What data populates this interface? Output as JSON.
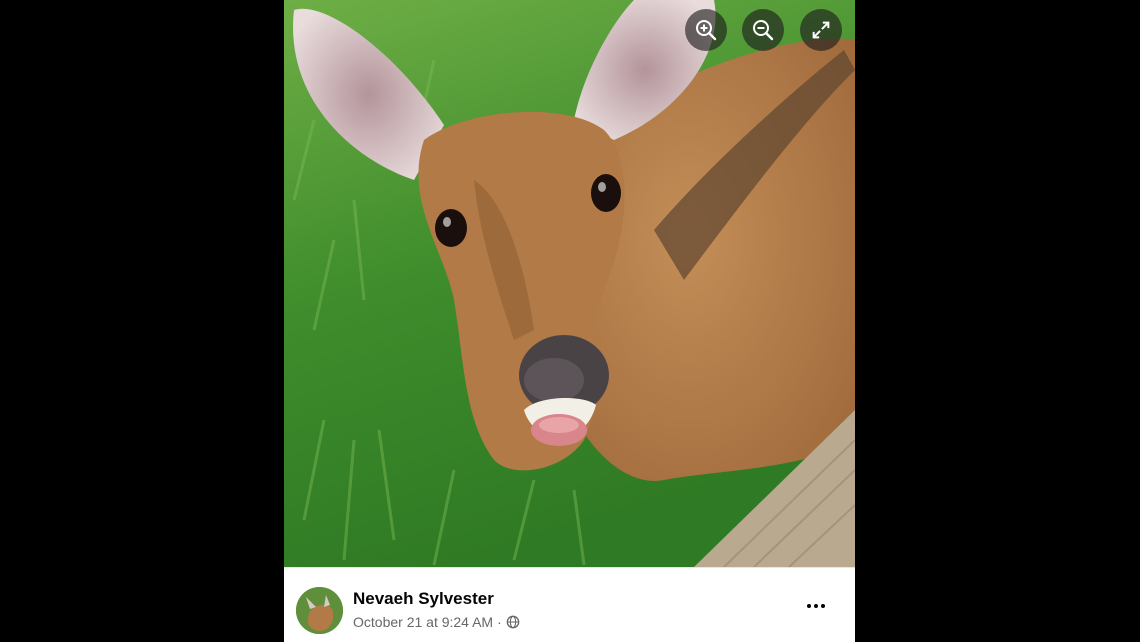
{
  "viewer": {
    "controls": {
      "zoom_in_icon": "magnifier-plus-icon",
      "zoom_out_icon": "magnifier-minus-icon",
      "fullscreen_icon": "expand-arrows-icon"
    }
  },
  "post": {
    "author_name": "Nevaeh Sylvester",
    "timestamp": "October 21 at 9:24 AM",
    "separator": "·",
    "audience_icon": "globe-icon",
    "more_icon": "ellipsis-icon"
  },
  "colors": {
    "background": "#000000",
    "grass": "#4f9a35",
    "deer_fur": "#b07a48",
    "footer_bg": "#ffffff",
    "meta_text": "#65676b"
  }
}
